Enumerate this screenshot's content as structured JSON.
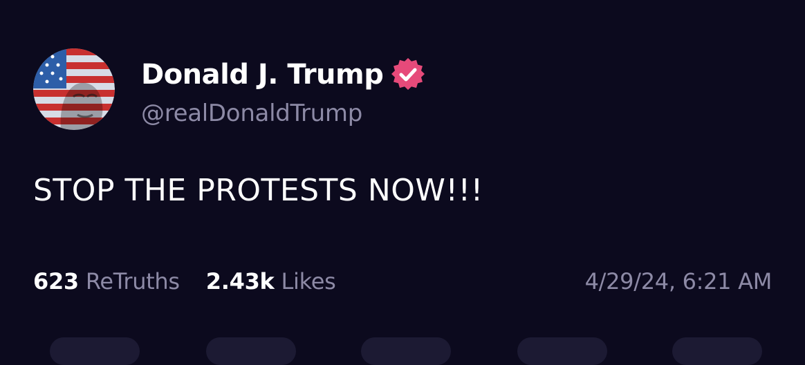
{
  "post": {
    "author": {
      "display_name": "Donald J. Trump",
      "handle": "@realDonaldTrump",
      "verified": true
    },
    "text": "STOP THE PROTESTS NOW!!!",
    "stats": {
      "retruths_count": "623",
      "retruths_label": "ReTruths",
      "likes_count": "2.43k",
      "likes_label": "Likes"
    },
    "timestamp": "4/29/24, 6:21 AM"
  },
  "colors": {
    "background": "#0c0a1e",
    "primary_text": "#ffffff",
    "secondary_text": "#8d8aa6",
    "verified_badge": "#e64a7a"
  },
  "icons": {
    "verified": "verified-badge-icon"
  }
}
